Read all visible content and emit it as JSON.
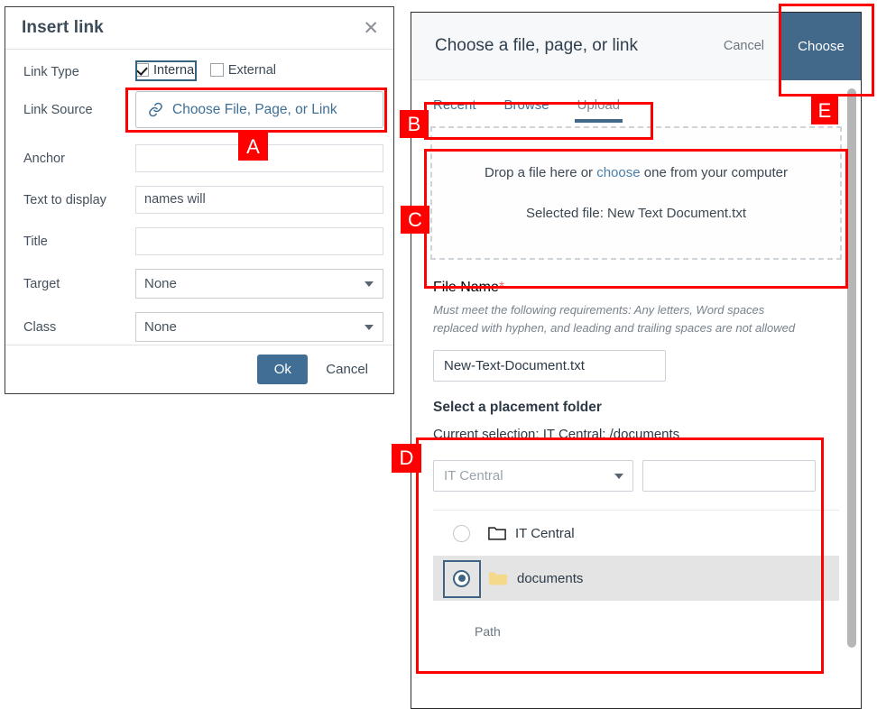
{
  "insert_link_dialog": {
    "title": "Insert link",
    "close_icon": "close-icon",
    "rows": {
      "link_type_label": "Link Type",
      "internal_label": "Internal",
      "external_label": "External",
      "link_source_label": "Link Source",
      "link_source_value": "Choose File, Page, or Link",
      "link_icon": "link-chain-icon",
      "anchor_label": "Anchor",
      "anchor_value": "",
      "text_to_display_label": "Text to display",
      "text_to_display_value": "names will",
      "title_label": "Title",
      "title_value": "",
      "target_label": "Target",
      "target_value": "None",
      "class_label": "Class",
      "class_value": "None"
    },
    "footer": {
      "ok_label": "Ok",
      "cancel_label": "Cancel"
    }
  },
  "choose_panel": {
    "header": {
      "title": "Choose a file, page, or link",
      "cancel_label": "Cancel",
      "choose_label": "Choose"
    },
    "tabs": [
      {
        "label": "Recent",
        "active": false
      },
      {
        "label": "Browse",
        "active": false
      },
      {
        "label": "Upload",
        "active": true
      }
    ],
    "dropzone": {
      "line1_before": "Drop a file here or ",
      "line1_link": "choose",
      "line1_after": " one from your computer",
      "selected_file": "Selected file: New Text Document.txt"
    },
    "file_name": {
      "label": "File Name",
      "required_marker": "*",
      "help": "Must meet the following requirements: Any letters, Word spaces replaced with hyphen, and leading and trailing spaces are not allowed",
      "value": "New-Text-Document.txt"
    },
    "placement": {
      "title": "Select a placement folder",
      "current_selection": "Current selection: IT Central: /documents",
      "select_value": "IT Central",
      "search_value": "",
      "folders": [
        {
          "name": "IT Central",
          "selected": false,
          "icon": "folder-outline-icon"
        },
        {
          "name": "documents",
          "selected": true,
          "icon": "folder-filled-icon"
        }
      ],
      "path_label": "Path"
    }
  },
  "annotations": [
    {
      "tag": "A"
    },
    {
      "tag": "B"
    },
    {
      "tag": "C"
    },
    {
      "tag": "D"
    },
    {
      "tag": "E"
    }
  ],
  "colors": {
    "accent_blue": "#42688a",
    "link_blue": "#3f6f96",
    "annotation_red": "#ff0000",
    "folder_yellow": "#f5d98b"
  }
}
